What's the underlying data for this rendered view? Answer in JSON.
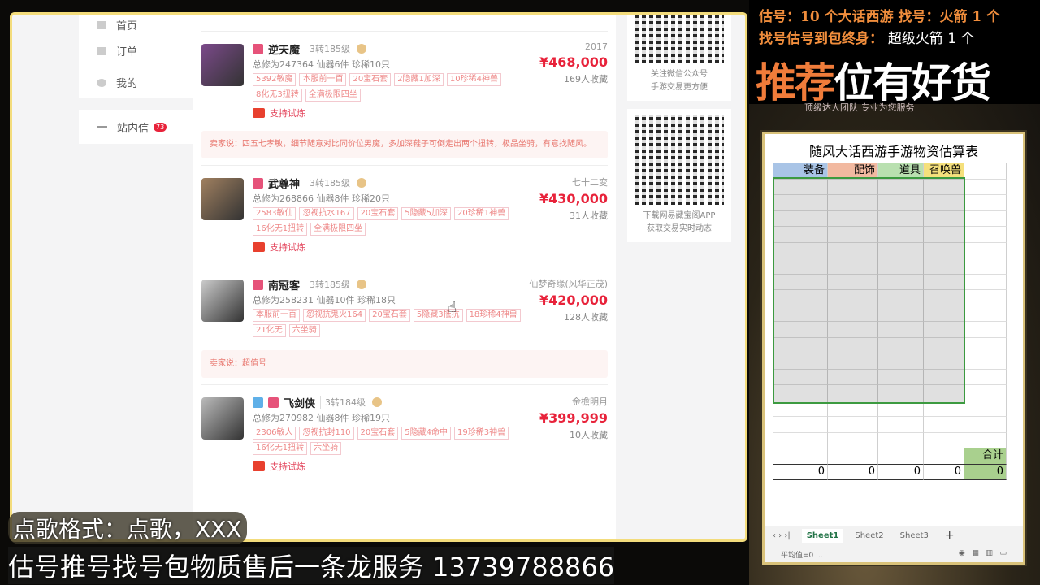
{
  "sidebar": {
    "items": [
      {
        "label": "首页"
      },
      {
        "label": "订单"
      },
      {
        "label": "我的"
      }
    ],
    "message": {
      "label": "站内信",
      "badge": "73"
    }
  },
  "listings": [
    {
      "name": "逆天魔",
      "level": "3转185级",
      "stats": "总修为247364  仙器6件  珍稀10只",
      "tags": [
        "5392敏魔",
        "本服前一百",
        "20宝石套",
        "2隐藏1加深",
        "10珍稀4神兽",
        "8化无3扭转",
        "全满极限四坐"
      ],
      "try": "支持试炼",
      "server": "2017",
      "price": "¥468,000",
      "fav": "169人收藏",
      "say": "卖家说：四五七孝敏，细节随意对比同价位男魔，多加深鞋子可倒走出两个扭转，极品坐骑，有意找随风。"
    },
    {
      "name": "武尊神",
      "level": "3转185级",
      "stats": "总修为268866  仙器8件  珍稀20只",
      "tags": [
        "2583敏仙",
        "忽视抗水167",
        "20宝石套",
        "5隐藏5加深",
        "20珍稀1神兽",
        "16化无1扭转",
        "全满极限四坐"
      ],
      "try": "支持试炼",
      "server": "七十二变",
      "price": "¥430,000",
      "fav": "31人收藏"
    },
    {
      "name": "南冠客",
      "level": "3转185级",
      "stats": "总修为258231  仙器10件  珍稀18只",
      "tags": [
        "本服前一百",
        "忽视抗鬼火164",
        "20宝石套",
        "5隐藏3抵抗",
        "18珍稀4神兽",
        "21化无",
        "六坐骑"
      ],
      "server": "仙梦奇缘(风华正茂)",
      "price": "¥420,000",
      "fav": "128人收藏",
      "say": "卖家说：超值号"
    },
    {
      "name": "飞剑侠",
      "level": "3转184级",
      "stats": "总修为270982  仙器8件  珍稀19只",
      "tags": [
        "2306敏人",
        "忽视抗封110",
        "20宝石套",
        "5隐藏4命中",
        "19珍稀3神兽",
        "16化无1扭转",
        "六坐骑"
      ],
      "try": "支持试炼",
      "server": "金檐明月",
      "price": "¥399,999",
      "fav": "10人收藏"
    }
  ],
  "qr": [
    {
      "line1": "关注微信公众号",
      "line2": "手游交易更方便"
    },
    {
      "line1": "下载网易藏宝阁APP",
      "line2": "获取交易实时动态"
    }
  ],
  "promo": {
    "line1a": "估号：10 个大话西游",
    "line1b": "找号：火箭 1 个",
    "line2a": "找号估号到包终身：",
    "line2b": "超级火箭 1 个",
    "big1": "推荐",
    "big2": "位有",
    "big3": "好货",
    "sub": "顶级达人团队 专业为您服务"
  },
  "sheet": {
    "title": "随风大话西游手游物资估算表",
    "headers": [
      "装备",
      "配饰",
      "道具",
      "召唤兽",
      ""
    ],
    "total_label": "合计",
    "totals": [
      "0",
      "0",
      "0",
      "0",
      "0"
    ],
    "tabs": [
      "Sheet1",
      "Sheet2",
      "Sheet3",
      "+"
    ],
    "status": "平均值=0 ..."
  },
  "overlay": {
    "line1": "点歌格式：点歌，XXX",
    "line2": "估号推号找号包物质售后一条龙服务 13739788866"
  }
}
